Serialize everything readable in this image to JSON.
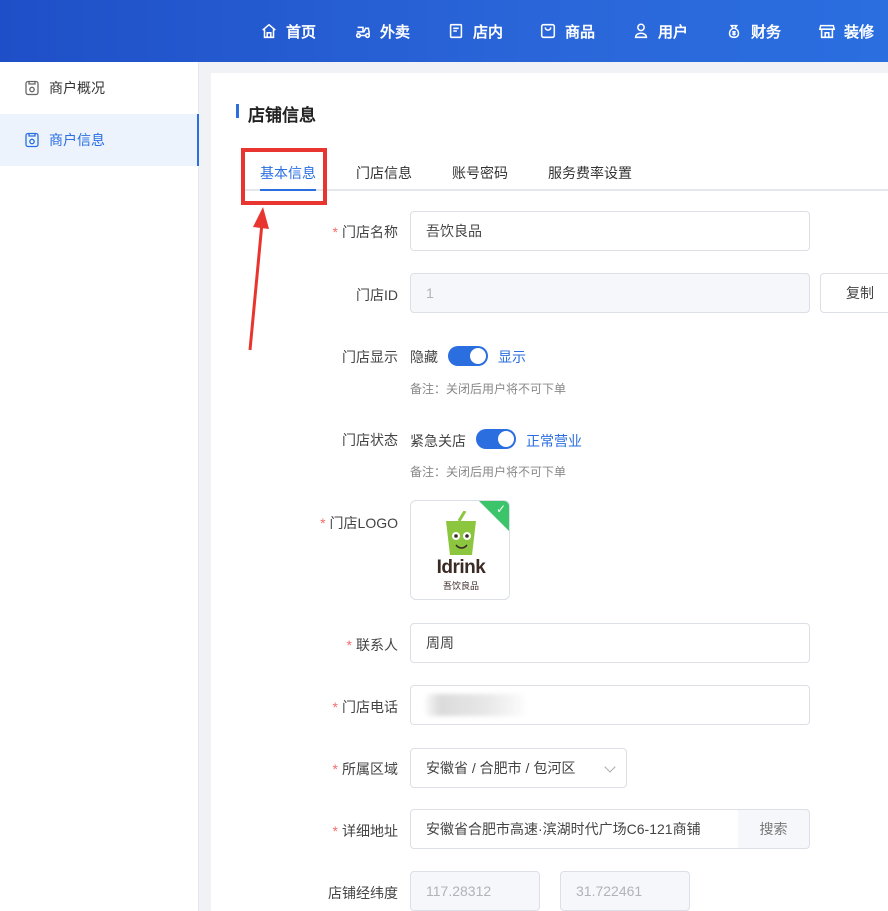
{
  "nav": {
    "items": [
      {
        "label": "首页",
        "icon": "home-icon"
      },
      {
        "label": "外卖",
        "icon": "delivery-icon"
      },
      {
        "label": "店内",
        "icon": "store-inside-icon"
      },
      {
        "label": "商品",
        "icon": "goods-icon"
      },
      {
        "label": "用户",
        "icon": "user-icon"
      },
      {
        "label": "财务",
        "icon": "finance-icon"
      },
      {
        "label": "装修",
        "icon": "decoration-icon"
      }
    ]
  },
  "sidebar": {
    "items": [
      {
        "label": "商户概况",
        "active": false
      },
      {
        "label": "商户信息",
        "active": true
      }
    ]
  },
  "page": {
    "title": "店铺信息"
  },
  "tabs": [
    {
      "label": "基本信息",
      "active": true
    },
    {
      "label": "门店信息",
      "active": false
    },
    {
      "label": "账号密码",
      "active": false
    },
    {
      "label": "服务费率设置",
      "active": false
    }
  ],
  "form": {
    "store_name": {
      "label": "门店名称",
      "required": "*",
      "value": "吾饮良品"
    },
    "store_id": {
      "label": "门店ID",
      "value": "1",
      "copy_label": "复制"
    },
    "store_display": {
      "label": "门店显示",
      "off_label": "隐藏",
      "on_label": "显示",
      "note": "备注：关闭后用户将不可下单"
    },
    "store_status": {
      "label": "门店状态",
      "off_label": "紧急关店",
      "on_label": "正常营业",
      "note": "备注：关闭后用户将不可下单"
    },
    "store_logo": {
      "label": "门店LOGO",
      "required": "*",
      "logo_text": "Idrink",
      "logo_sub": "吾饮良品"
    },
    "contact": {
      "label": "联系人",
      "required": "*",
      "value": "周周"
    },
    "phone": {
      "label": "门店电话",
      "required": "*"
    },
    "region": {
      "label": "所属区域",
      "required": "*",
      "value": "安徽省 / 合肥市 / 包河区"
    },
    "address": {
      "label": "详细地址",
      "required": "*",
      "value": "安徽省合肥市高速·滨湖时代广场C6-121商铺",
      "search_label": "搜索"
    },
    "coords": {
      "label": "店铺经纬度",
      "lng": "117.28312",
      "lat": "31.722461"
    }
  },
  "colors": {
    "accent": "#2a6ee0",
    "highlight": "#e8352f"
  }
}
